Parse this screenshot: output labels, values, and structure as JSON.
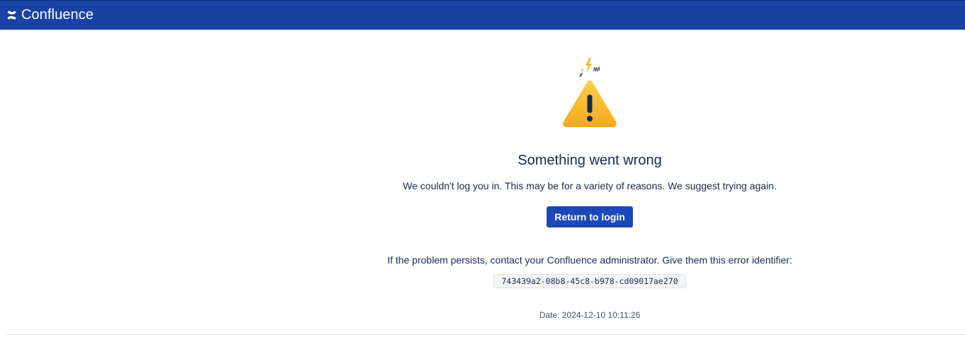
{
  "header": {
    "brand_name": "Confluence",
    "brand_icon": "confluence-logo-icon",
    "background_color": "#1842a4"
  },
  "error": {
    "illustration": "warning-triangle-icon",
    "title": "Something went wrong",
    "message": "We couldn't log you in. This may be for a variety of reasons. We suggest trying again.",
    "button_label": "Return to login",
    "persist_message": "If the problem persists, contact your Confluence administrator. Give them this error identifier:",
    "error_identifier": "743439a2-08b8-45c8-b978-cd09017ae270",
    "date": "Date: 2024-12-10 10:11:26"
  },
  "colors": {
    "accent": "#1c48b8",
    "warning": "#f5b72c",
    "text": "#172b4d"
  }
}
